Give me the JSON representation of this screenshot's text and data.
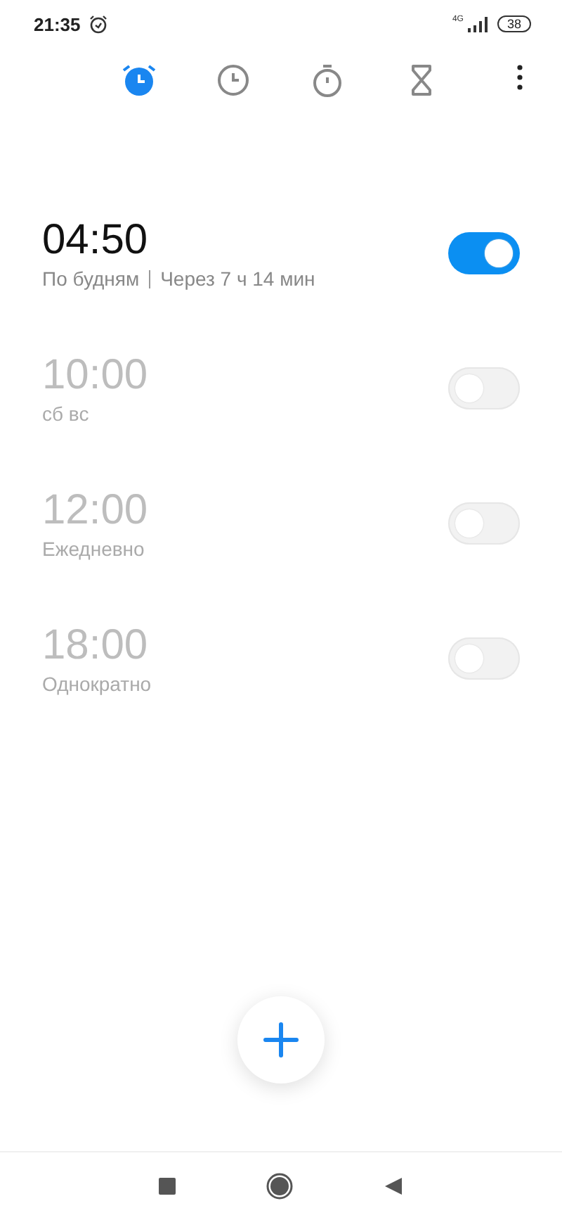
{
  "status_bar": {
    "time": "21:35",
    "network": "4G",
    "battery": "38"
  },
  "tabs": [
    {
      "kind": "alarm",
      "selected": true
    },
    {
      "kind": "clock",
      "selected": false
    },
    {
      "kind": "stopwatch",
      "selected": false
    },
    {
      "kind": "timer",
      "selected": false
    }
  ],
  "alarms": [
    {
      "time": "04:50",
      "repeat": "По будням",
      "countdown": "Через 7 ч 14 мин",
      "on": true
    },
    {
      "time": "10:00",
      "repeat": "сб вс",
      "on": false
    },
    {
      "time": "12:00",
      "repeat": "Ежедневно",
      "on": false
    },
    {
      "time": "18:00",
      "repeat": "Однократно",
      "on": false
    }
  ]
}
